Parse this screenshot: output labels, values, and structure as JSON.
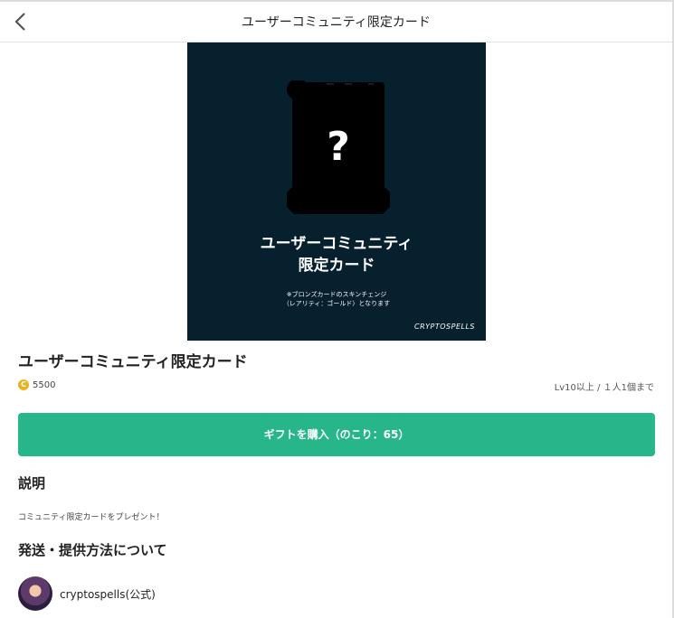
{
  "header": {
    "title": "ユーザーコミュニティ限定カード",
    "back_icon": "chevron-left-icon"
  },
  "promo_image": {
    "question_mark": "?",
    "title_line1": "ユーザーコミュニティ",
    "title_line2": "限定カード",
    "note_line1": "※ブロンズカードのスキンチェンジ",
    "note_line2": "（レアリティ：ゴールド）となります",
    "logo_text": "CRYPTOSPELLS",
    "background_color": "#06202e"
  },
  "item": {
    "title": "ユーザーコミュニティ限定カード",
    "coin_icon": "coin-icon",
    "coin_symbol": "C",
    "price": "5500",
    "limits": "Lv10以上 / １人1個まで"
  },
  "buy_button": {
    "label": "ギフトを購入（のこり：65）",
    "color": "#26b68a"
  },
  "description": {
    "heading": "説明",
    "text": "コミュニティ限定カードをプレゼント！"
  },
  "delivery": {
    "heading": "発送・提供方法について",
    "seller_name": "cryptospells(公式)"
  }
}
